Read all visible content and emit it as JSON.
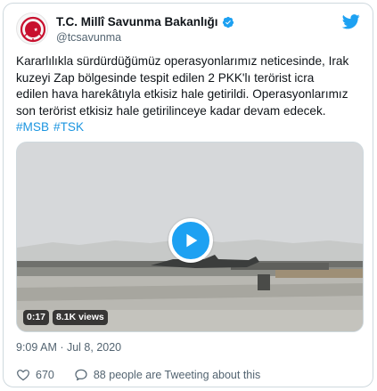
{
  "account": {
    "display_name": "T.C. Millî Savunma Bakanlığı",
    "handle": "@tcsavunma",
    "verified": true,
    "avatar_icon": "ministry-emblem-icon"
  },
  "brand": {
    "icon": "twitter-bird-icon",
    "color": "#1da1f2"
  },
  "tweet": {
    "text": "Kararlılıkla sürdürdüğümüz operasyonlarımız neticesinde, Irak\nkuzeyi Zap bölgesinde tespit edilen 2 PKK'lı terörist icra\nedilen hava harekâtıyla etkisiz hale getirildi. Operasyonlarımız\nson terörist etkisiz hale getirilinceye kadar devam edecek.",
    "hashtags": [
      "#MSB",
      "#TSK"
    ],
    "link_color": "#1b95e0"
  },
  "media": {
    "type": "video",
    "play_icon": "play-icon",
    "duration": "0:17",
    "views": "8.1K views"
  },
  "timestamp": "9:09 AM · Jul 8, 2020",
  "actions": {
    "likes": "670",
    "people_talking": "88 people are Tweeting about this"
  }
}
